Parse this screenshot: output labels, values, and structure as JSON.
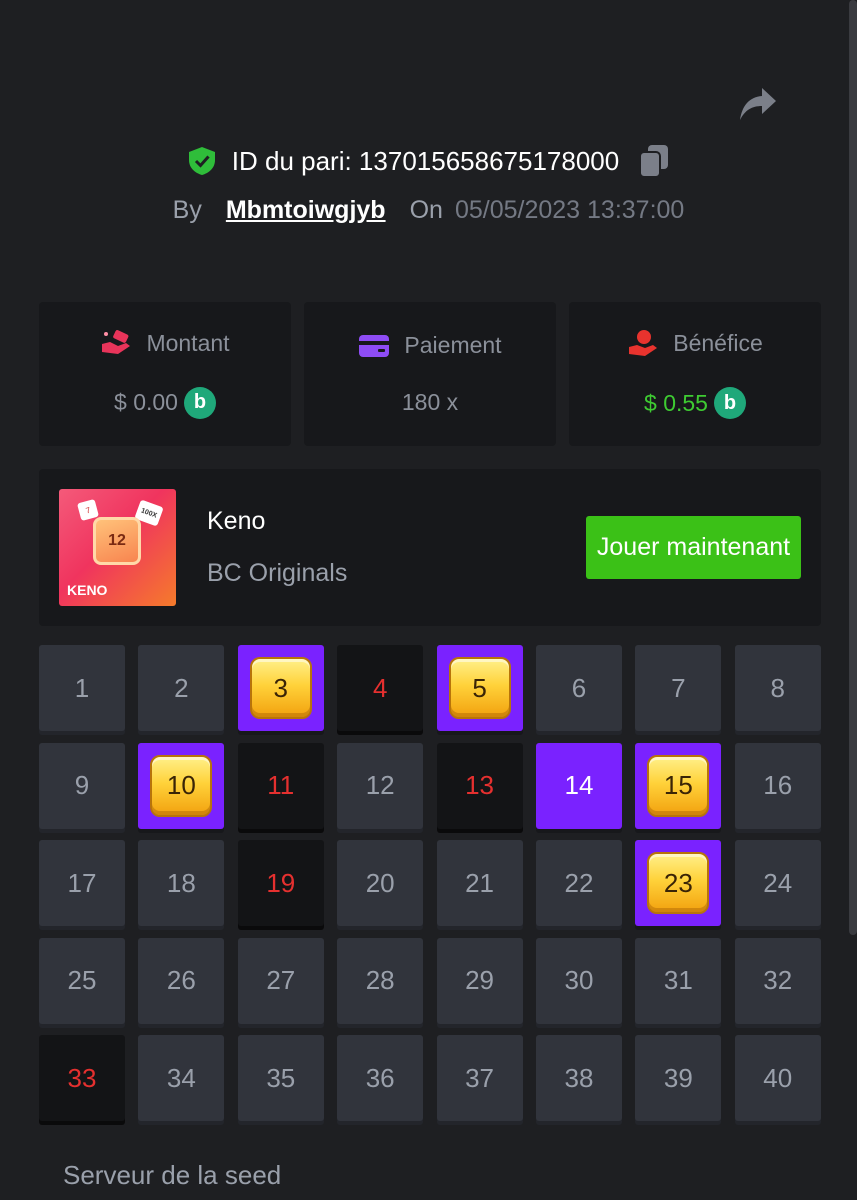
{
  "header": {
    "bet_id_label": "ID du pari: 137015658675178000",
    "by_label": "By",
    "username": "Mbmtoiwgjyb",
    "on_label": "On",
    "datetime": "05/05/2023 13:37:00"
  },
  "stats": {
    "amount": {
      "label": "Montant",
      "value": "$ 0.00",
      "icon": "money-hand-icon",
      "coin": "bc-coin-icon"
    },
    "payout": {
      "label": "Paiement",
      "value": "180 x",
      "icon": "card-icon"
    },
    "profit": {
      "label": "Bénéfice",
      "value": "$ 0.55",
      "icon": "profit-hand-icon",
      "coin": "bc-coin-icon"
    }
  },
  "game": {
    "name": "Keno",
    "provider": "BC Originals",
    "play_label": "Jouer maintenant",
    "thumb_label": "KENO",
    "thumb_number": "12",
    "thumb_die1": "7",
    "thumb_die2": "100X"
  },
  "grid": {
    "cells": [
      {
        "n": "1",
        "state": "normal"
      },
      {
        "n": "2",
        "state": "normal"
      },
      {
        "n": "3",
        "state": "hit"
      },
      {
        "n": "4",
        "state": "dark"
      },
      {
        "n": "5",
        "state": "hit"
      },
      {
        "n": "6",
        "state": "normal"
      },
      {
        "n": "7",
        "state": "normal"
      },
      {
        "n": "8",
        "state": "normal"
      },
      {
        "n": "9",
        "state": "normal"
      },
      {
        "n": "10",
        "state": "hit"
      },
      {
        "n": "11",
        "state": "dark"
      },
      {
        "n": "12",
        "state": "normal"
      },
      {
        "n": "13",
        "state": "dark"
      },
      {
        "n": "14",
        "state": "picked"
      },
      {
        "n": "15",
        "state": "hit"
      },
      {
        "n": "16",
        "state": "normal"
      },
      {
        "n": "17",
        "state": "normal"
      },
      {
        "n": "18",
        "state": "normal"
      },
      {
        "n": "19",
        "state": "dark"
      },
      {
        "n": "20",
        "state": "normal"
      },
      {
        "n": "21",
        "state": "normal"
      },
      {
        "n": "22",
        "state": "normal"
      },
      {
        "n": "23",
        "state": "hit"
      },
      {
        "n": "24",
        "state": "normal"
      },
      {
        "n": "25",
        "state": "normal"
      },
      {
        "n": "26",
        "state": "normal"
      },
      {
        "n": "27",
        "state": "normal"
      },
      {
        "n": "28",
        "state": "normal"
      },
      {
        "n": "29",
        "state": "normal"
      },
      {
        "n": "30",
        "state": "normal"
      },
      {
        "n": "31",
        "state": "normal"
      },
      {
        "n": "32",
        "state": "normal"
      },
      {
        "n": "33",
        "state": "dark"
      },
      {
        "n": "34",
        "state": "normal"
      },
      {
        "n": "35",
        "state": "normal"
      },
      {
        "n": "36",
        "state": "normal"
      },
      {
        "n": "37",
        "state": "normal"
      },
      {
        "n": "38",
        "state": "normal"
      },
      {
        "n": "39",
        "state": "normal"
      },
      {
        "n": "40",
        "state": "normal"
      }
    ]
  },
  "seed": {
    "label": "Serveur de la seed"
  },
  "colors": {
    "background": "#1e1f22",
    "panel": "#17181b",
    "accent_purple": "#7a22ff",
    "play_green": "#3bc117",
    "profit_green": "#3ecb32",
    "miss_red": "#e5302f"
  }
}
